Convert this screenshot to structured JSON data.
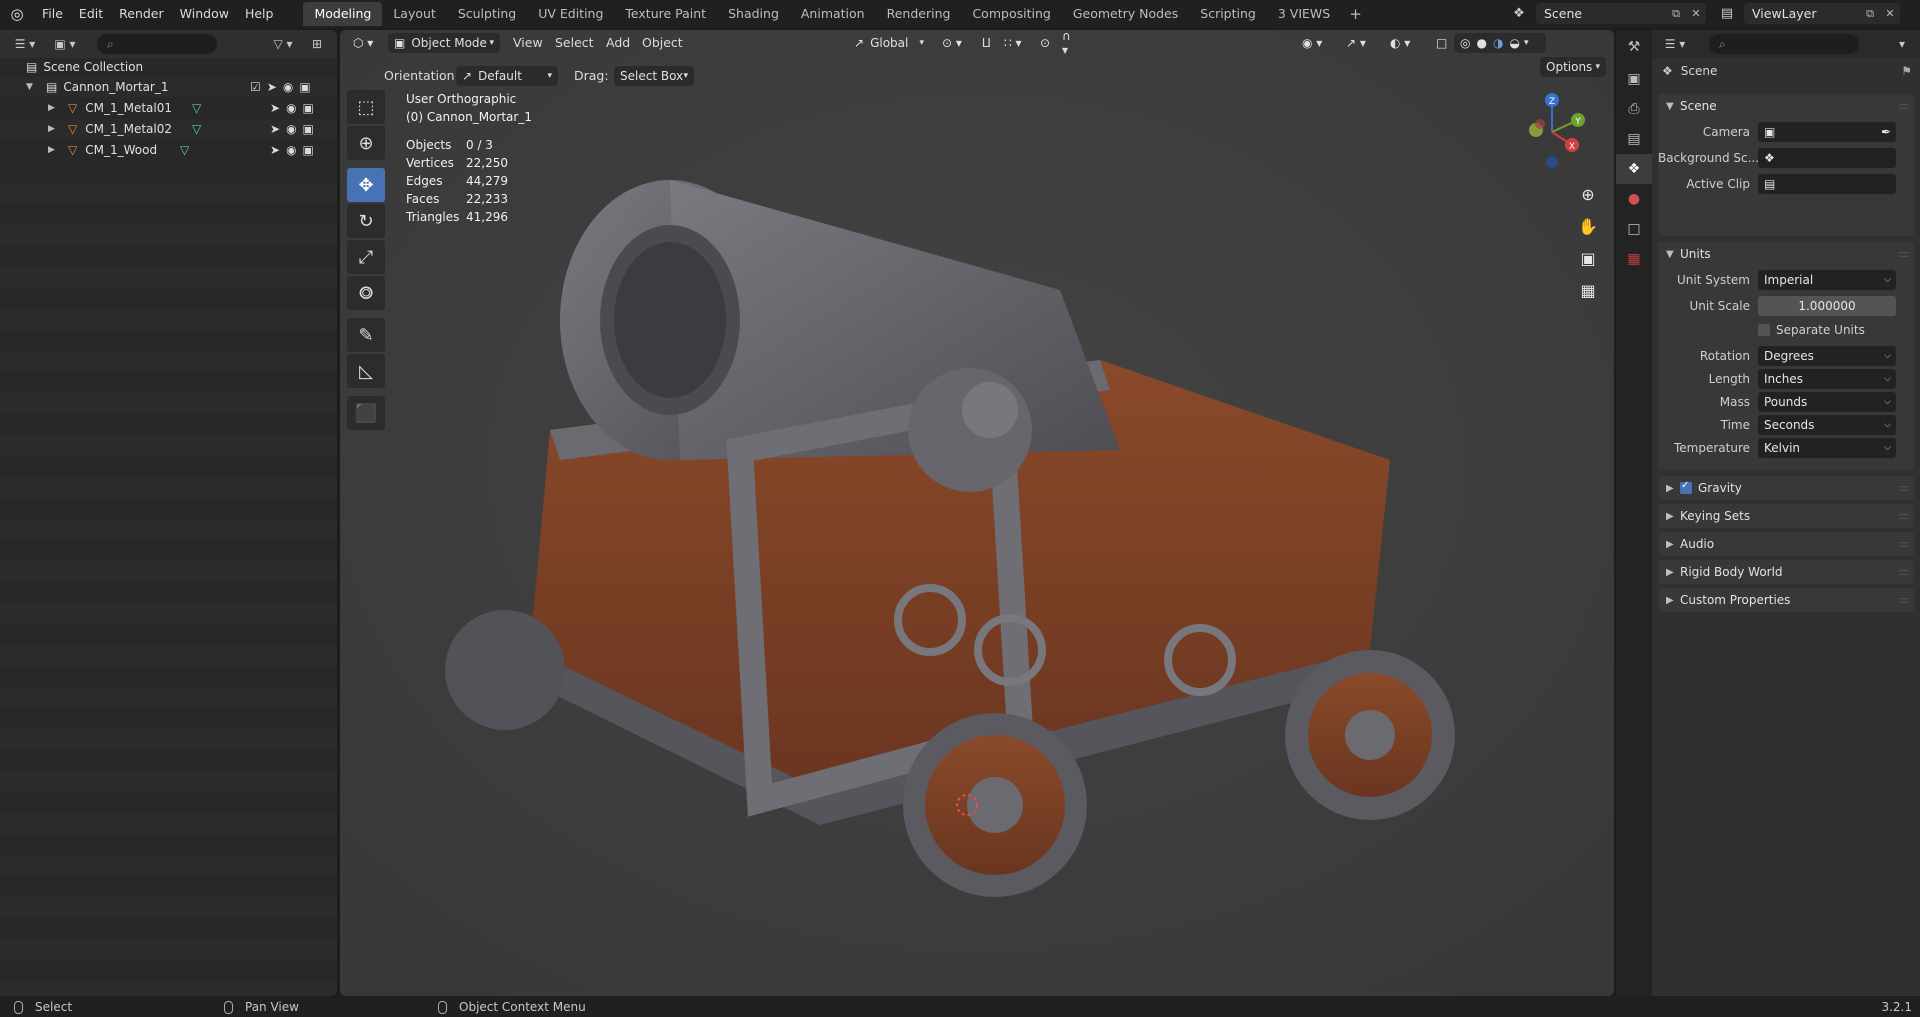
{
  "topbar": {
    "menus": [
      "File",
      "Edit",
      "Render",
      "Window",
      "Help"
    ],
    "workspaces": [
      "Modeling",
      "Layout",
      "Sculpting",
      "UV Editing",
      "Texture Paint",
      "Shading",
      "Animation",
      "Rendering",
      "Compositing",
      "Geometry Nodes",
      "Scripting",
      "3 VIEWS"
    ],
    "active_workspace": "Modeling",
    "scene_name": "Scene",
    "view_layer": "ViewLayer"
  },
  "outliner": {
    "collection": "Scene Collection",
    "root": "Cannon_Mortar_1",
    "children": [
      "CM_1_Metal01",
      "CM_1_Metal02",
      "CM_1_Wood"
    ]
  },
  "viewport": {
    "mode": "Object Mode",
    "menus": [
      "View",
      "Select",
      "Add",
      "Object"
    ],
    "transform_orientation": "Global",
    "orientation_label": "Orientation:",
    "orientation_value": "Default",
    "drag_label": "Drag:",
    "drag_value": "Select Box",
    "options_label": "Options",
    "view_name": "User Orthographic",
    "object_name": "(0) Cannon_Mortar_1",
    "stats": {
      "objects_label": "Objects",
      "objects": "0 / 3",
      "vertices_label": "Vertices",
      "vertices": "22,250",
      "edges_label": "Edges",
      "edges": "44,279",
      "faces_label": "Faces",
      "faces": "22,233",
      "triangles_label": "Triangles",
      "triangles": "41,296"
    },
    "gizmo_axes": [
      "Z",
      "Y",
      "X"
    ]
  },
  "properties": {
    "context": "Scene",
    "scene_panel": {
      "title": "Scene",
      "camera_label": "Camera",
      "background_label": "Background Sc...",
      "active_clip_label": "Active Clip"
    },
    "units_panel": {
      "title": "Units",
      "unit_system_label": "Unit System",
      "unit_system": "Imperial",
      "unit_scale_label": "Unit Scale",
      "unit_scale": "1.000000",
      "separate_units": "Separate Units",
      "rotation_label": "Rotation",
      "rotation": "Degrees",
      "length_label": "Length",
      "length": "Inches",
      "mass_label": "Mass",
      "mass": "Pounds",
      "time_label": "Time",
      "time": "Seconds",
      "temperature_label": "Temperature",
      "temperature": "Kelvin"
    },
    "collapsed_panels": [
      "Gravity",
      "Keying Sets",
      "Audio",
      "Rigid Body World",
      "Custom Properties"
    ]
  },
  "statusbar": {
    "select": "Select",
    "pan": "Pan View",
    "context_menu": "Object Context Menu",
    "version": "3.2.1"
  },
  "colors": {
    "accent": "#4772b3",
    "object_orange": "#e08a3c",
    "mesh_green": "#5fd0a0",
    "viewport_bg": "#3d3d3d"
  }
}
